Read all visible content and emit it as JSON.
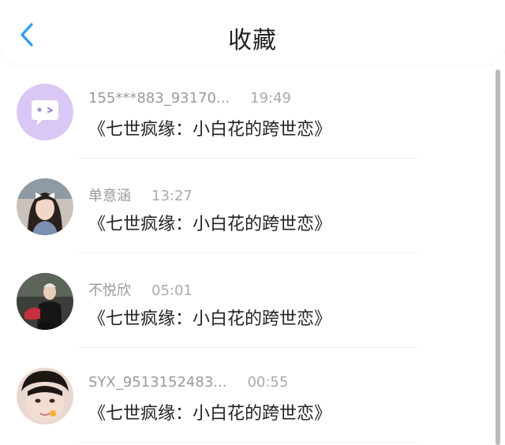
{
  "header": {
    "title": "收藏",
    "back_icon": "chevron-left-icon",
    "accent_color": "#2f9bf0"
  },
  "favorites": [
    {
      "username": "155***883_93170...",
      "time": "19:49",
      "title": "《七世疯缘：小白花的跨世恋》",
      "avatar": "purple-wink-chat-bubble-avatar"
    },
    {
      "username": "单意涵",
      "time": "13:27",
      "title": "《七世疯缘：小白花的跨世恋》",
      "avatar": "girl-with-hair-bow-photo-avatar"
    },
    {
      "username": "不悦欣",
      "time": "05:01",
      "title": "《七世疯缘：小白花的跨世恋》",
      "avatar": "person-in-dark-jacket-photo-avatar"
    },
    {
      "username": "SYX_9513152483...",
      "time": "00:55",
      "title": "《七世疯缘：小白花的跨世恋》",
      "avatar": "close-up-face-photo-avatar"
    }
  ]
}
